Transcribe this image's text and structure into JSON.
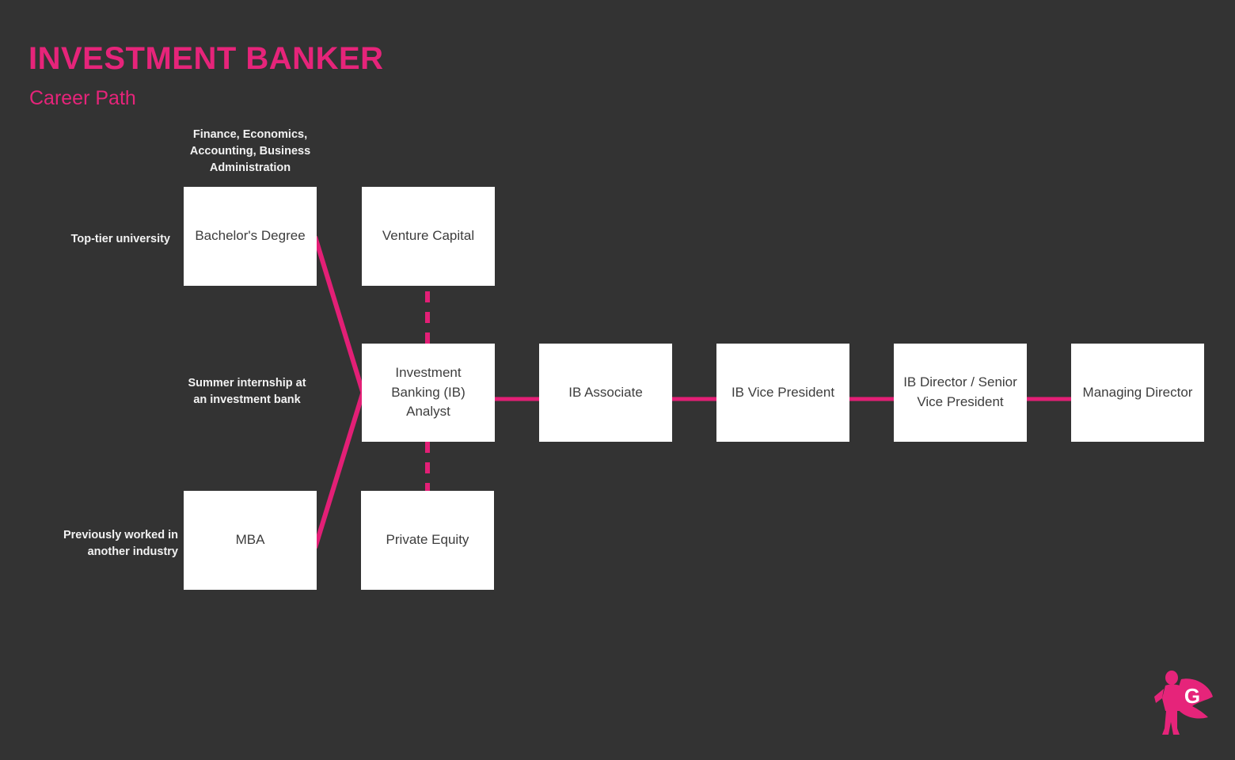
{
  "header": {
    "title": "INVESTMENT BANKER",
    "subtitle": "Career Path"
  },
  "colors": {
    "background": "#333333",
    "accent_pink": "#e6247a",
    "connector_pink": "#e31f76",
    "node_fill": "#ffffff",
    "node_text": "#3d3d3d",
    "label_text": "#f2f2f2"
  },
  "annotations": [
    {
      "id": "degree-fields",
      "text": "Finance, Economics, Accounting, Business Administration"
    },
    {
      "id": "university-tier",
      "text": "Top-tier university"
    },
    {
      "id": "internship",
      "text": "Summer internship at an investment bank"
    },
    {
      "id": "prior-industry",
      "text": "Previously worked in another industry"
    }
  ],
  "nodes": [
    {
      "id": "bachelors-degree",
      "label": "Bachelor's Degree"
    },
    {
      "id": "venture-capital",
      "label": "Venture Capital"
    },
    {
      "id": "ib-analyst",
      "label": "Investment Banking (IB) Analyst"
    },
    {
      "id": "ib-associate",
      "label": "IB Associate"
    },
    {
      "id": "ib-vice-president",
      "label": "IB Vice President"
    },
    {
      "id": "ib-director",
      "label": "IB Director / Senior Vice President"
    },
    {
      "id": "managing-director",
      "label": "Managing Director"
    },
    {
      "id": "mba",
      "label": "MBA"
    },
    {
      "id": "private-equity",
      "label": "Private Equity"
    }
  ],
  "connections": [
    {
      "from": "bachelors-degree",
      "to": "ib-analyst",
      "style": "solid"
    },
    {
      "from": "mba",
      "to": "ib-analyst",
      "style": "solid"
    },
    {
      "from": "ib-analyst",
      "to": "venture-capital",
      "style": "dashed"
    },
    {
      "from": "ib-analyst",
      "to": "private-equity",
      "style": "dashed"
    },
    {
      "from": "ib-analyst",
      "to": "ib-associate",
      "style": "solid"
    },
    {
      "from": "ib-associate",
      "to": "ib-vice-president",
      "style": "solid"
    },
    {
      "from": "ib-vice-president",
      "to": "ib-director",
      "style": "solid"
    },
    {
      "from": "ib-director",
      "to": "managing-director",
      "style": "solid"
    }
  ],
  "logo": {
    "name": "superhero-g-logo",
    "letter": "G"
  }
}
